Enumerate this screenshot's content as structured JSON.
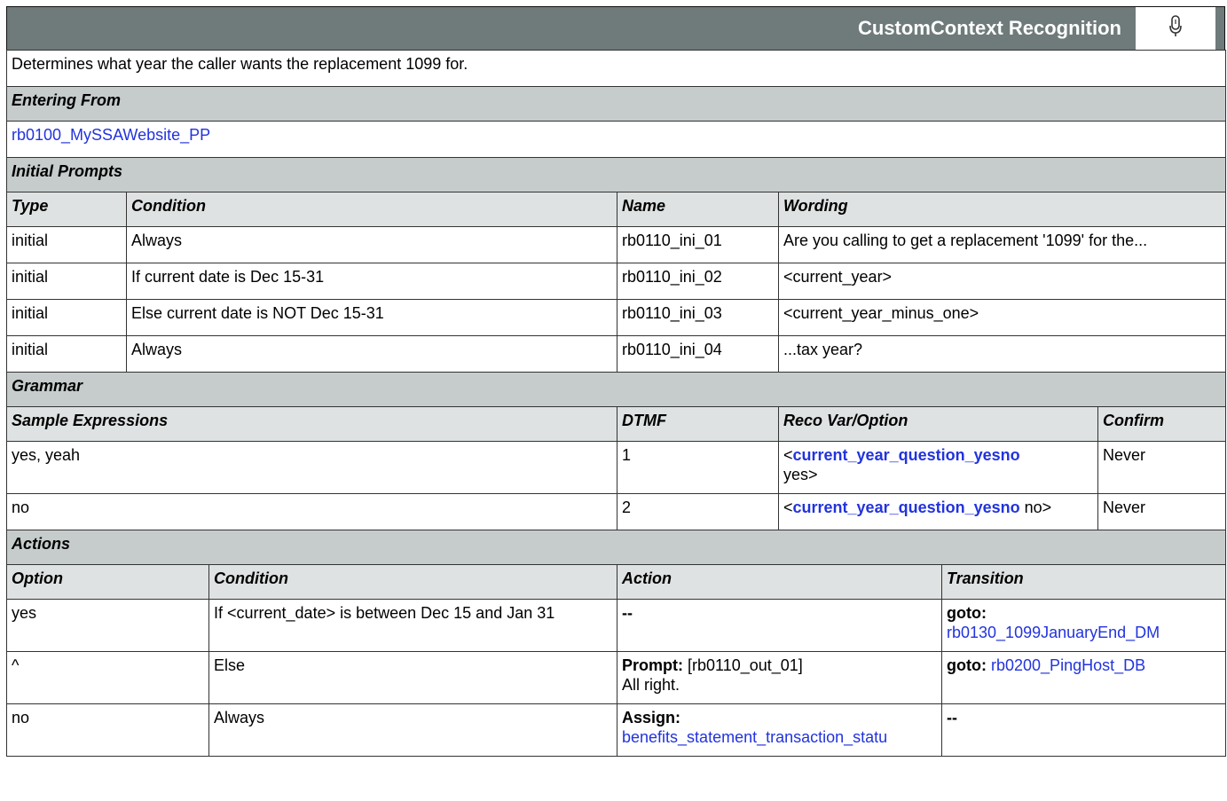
{
  "header": {
    "title": "CustomContext Recognition",
    "icon": "microphone-icon"
  },
  "description": "Determines what year the caller wants the replacement 1099 for.",
  "entering_from": {
    "heading": "Entering From",
    "link": "rb0100_MySSAWebsite_PP"
  },
  "initial_prompts": {
    "heading": "Initial Prompts",
    "columns": [
      "Type",
      "Condition",
      "Name",
      "Wording"
    ],
    "rows": [
      {
        "type": "initial",
        "condition": "Always",
        "name": "rb0110_ini_01",
        "wording": "Are you calling to get a replacement '1099' for the..."
      },
      {
        "type": "initial",
        "condition": "If current date is Dec 15-31",
        "name": "rb0110_ini_02",
        "wording": "<current_year>"
      },
      {
        "type": "initial",
        "condition": "Else current date is NOT Dec 15-31",
        "name": "rb0110_ini_03",
        "wording": "<current_year_minus_one>"
      },
      {
        "type": "initial",
        "condition": "Always",
        "name": "rb0110_ini_04",
        "wording": "...tax year?"
      }
    ]
  },
  "grammar": {
    "heading": "Grammar",
    "columns": [
      "Sample Expressions",
      "DTMF",
      "Reco Var/Option",
      "Confirm"
    ],
    "rows": [
      {
        "expr": "yes, yeah",
        "dtmf": "1",
        "var_open": "<",
        "var_link": "current_year_question_yesno",
        "var_tail": "yes>",
        "confirm": "Never"
      },
      {
        "expr": "no",
        "dtmf": "2",
        "var_open": "<",
        "var_link": "current_year_question_yesno",
        "var_tail": "no>",
        "confirm": "Never"
      }
    ]
  },
  "actions": {
    "heading": "Actions",
    "columns": [
      "Option",
      "Condition",
      "Action",
      "Transition"
    ],
    "rows": [
      {
        "option": "yes",
        "condition": "If <current_date> is between Dec 15 and Jan 31",
        "action_label": "",
        "action_text": "--",
        "action_link": "",
        "trans_label": "goto:",
        "trans_link": "rb0130_1099JanuaryEnd_DM"
      },
      {
        "option": "^",
        "condition": "Else",
        "action_label": "Prompt:",
        "action_text": "[rb0110_out_01]",
        "action_text2": "All right.",
        "action_link": "",
        "trans_label": "goto:",
        "trans_link": "rb0200_PingHost_DB"
      },
      {
        "option": "no",
        "condition": "Always",
        "action_label": "Assign:",
        "action_text": "",
        "action_link": "benefits_statement_transaction_statu",
        "trans_label": "",
        "trans_link": "",
        "trans_text": "--"
      }
    ]
  }
}
